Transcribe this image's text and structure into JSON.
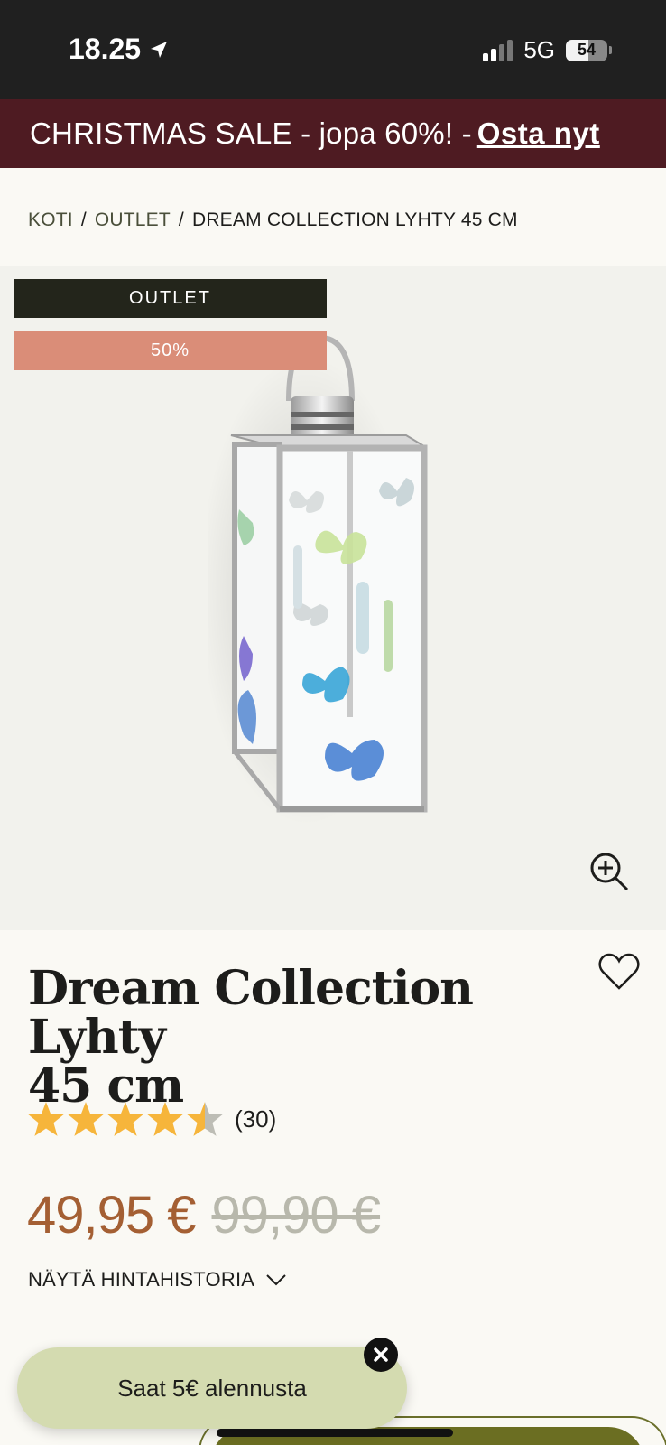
{
  "status_bar": {
    "time": "18.25",
    "network": "5G",
    "battery": "54",
    "battery_level": 0.54
  },
  "promo": {
    "text": "CHRISTMAS SALE - jopa 60%!  -",
    "link": " Osta nyt"
  },
  "breadcrumb": {
    "home": "KOTI",
    "separator": "/",
    "category": "OUTLET",
    "current": "DREAM COLLECTION LYHTY 45 CM"
  },
  "gallery": {
    "badge_outlet": "OUTLET",
    "badge_discount": "50%",
    "zoom_icon": "zoom-in-icon"
  },
  "product": {
    "title_line1": "Dream Collection Lyhty",
    "title_line2": "45 cm",
    "rating": 4.5,
    "review_count": "(30)",
    "price_current": "49,95 €",
    "price_old": "99,90 €",
    "price_history_label": "NÄYTÄ HINTAHISTORIA"
  },
  "discount_popup": {
    "label": "Saat 5€ alennusta"
  },
  "colors": {
    "promo_bg": "#4e1b22",
    "price_current": "#a45f33",
    "star": "#f6b53b",
    "discount_badge": "#da8d78",
    "popup_bg": "#d4dbb0"
  }
}
